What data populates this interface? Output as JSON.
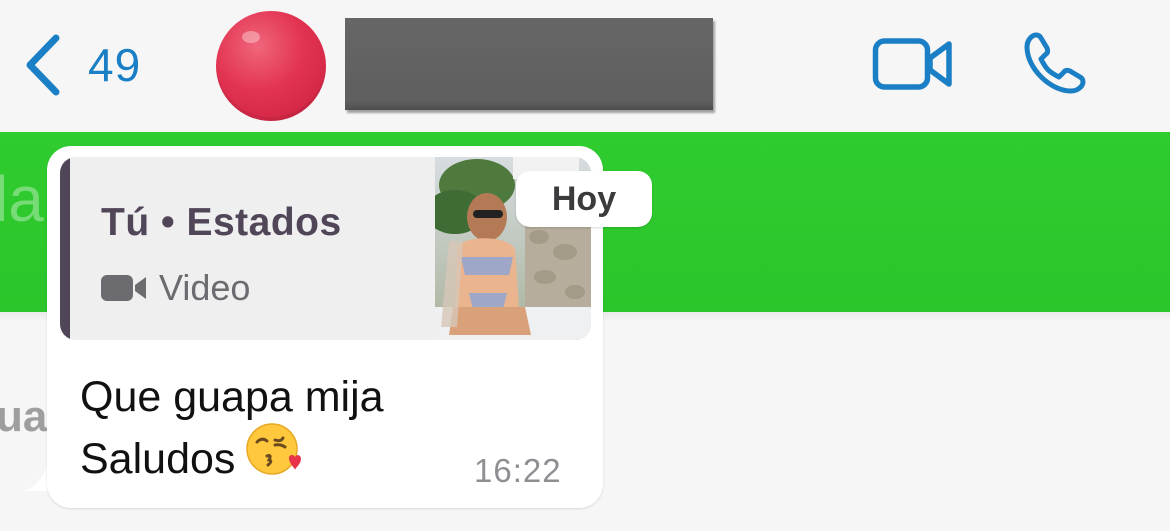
{
  "header": {
    "back_count": "49",
    "contact_name": "",
    "icons": [
      "chevron-left-icon",
      "video-camera-icon",
      "phone-icon"
    ],
    "accent_color": "#1a7fc4"
  },
  "background": {
    "status_band_color": "#2ec92e",
    "band_partial_text": "la",
    "behind_partial_text": "ua"
  },
  "date_chip": {
    "label": "Hoy"
  },
  "message": {
    "quote": {
      "author": "Tú • Estados",
      "type_label": "Video",
      "bar_color": "#514558"
    },
    "text_line1": "Que guapa mija",
    "text_line2": "Saludos",
    "emoji": "face-blowing-a-kiss",
    "time": "16:22"
  }
}
